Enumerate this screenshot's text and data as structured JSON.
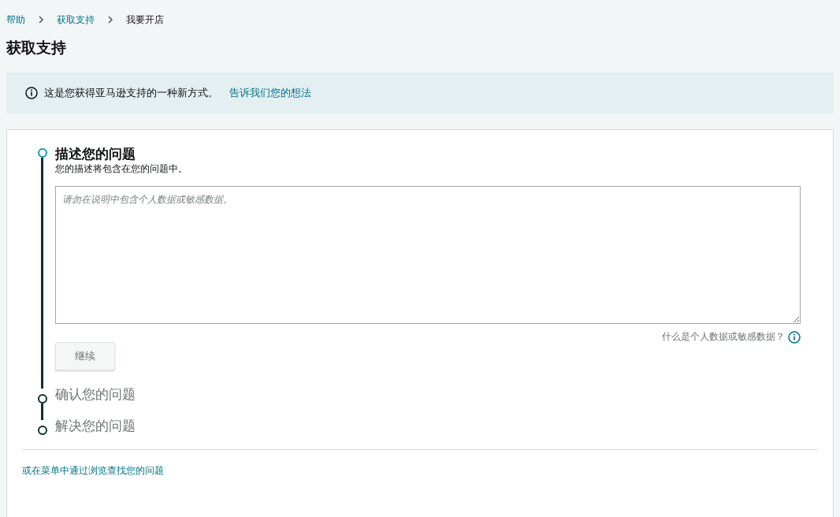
{
  "breadcrumb": [
    {
      "label": "帮助",
      "current": false
    },
    {
      "label": "获取支持",
      "current": false
    },
    {
      "label": "我要开店",
      "current": true
    }
  ],
  "page_title": "获取支持",
  "notice": {
    "text": "这是您获得亚马逊支持的一种新方式。",
    "link": "告诉我们您的想法"
  },
  "steps": [
    {
      "title": "描述您的问题",
      "active": true,
      "subtitle": "您的描述将包含在您的问题中。",
      "placeholder": "请勿在说明中包含个人数据或敏感数据。",
      "help_link": "什么是个人数据或敏感数据？",
      "button": "继续"
    },
    {
      "title": "确认您的问题",
      "active": false
    },
    {
      "title": "解决您的问题",
      "active": false
    }
  ],
  "browse_link": "或在菜单中通过浏览查找您的问题"
}
